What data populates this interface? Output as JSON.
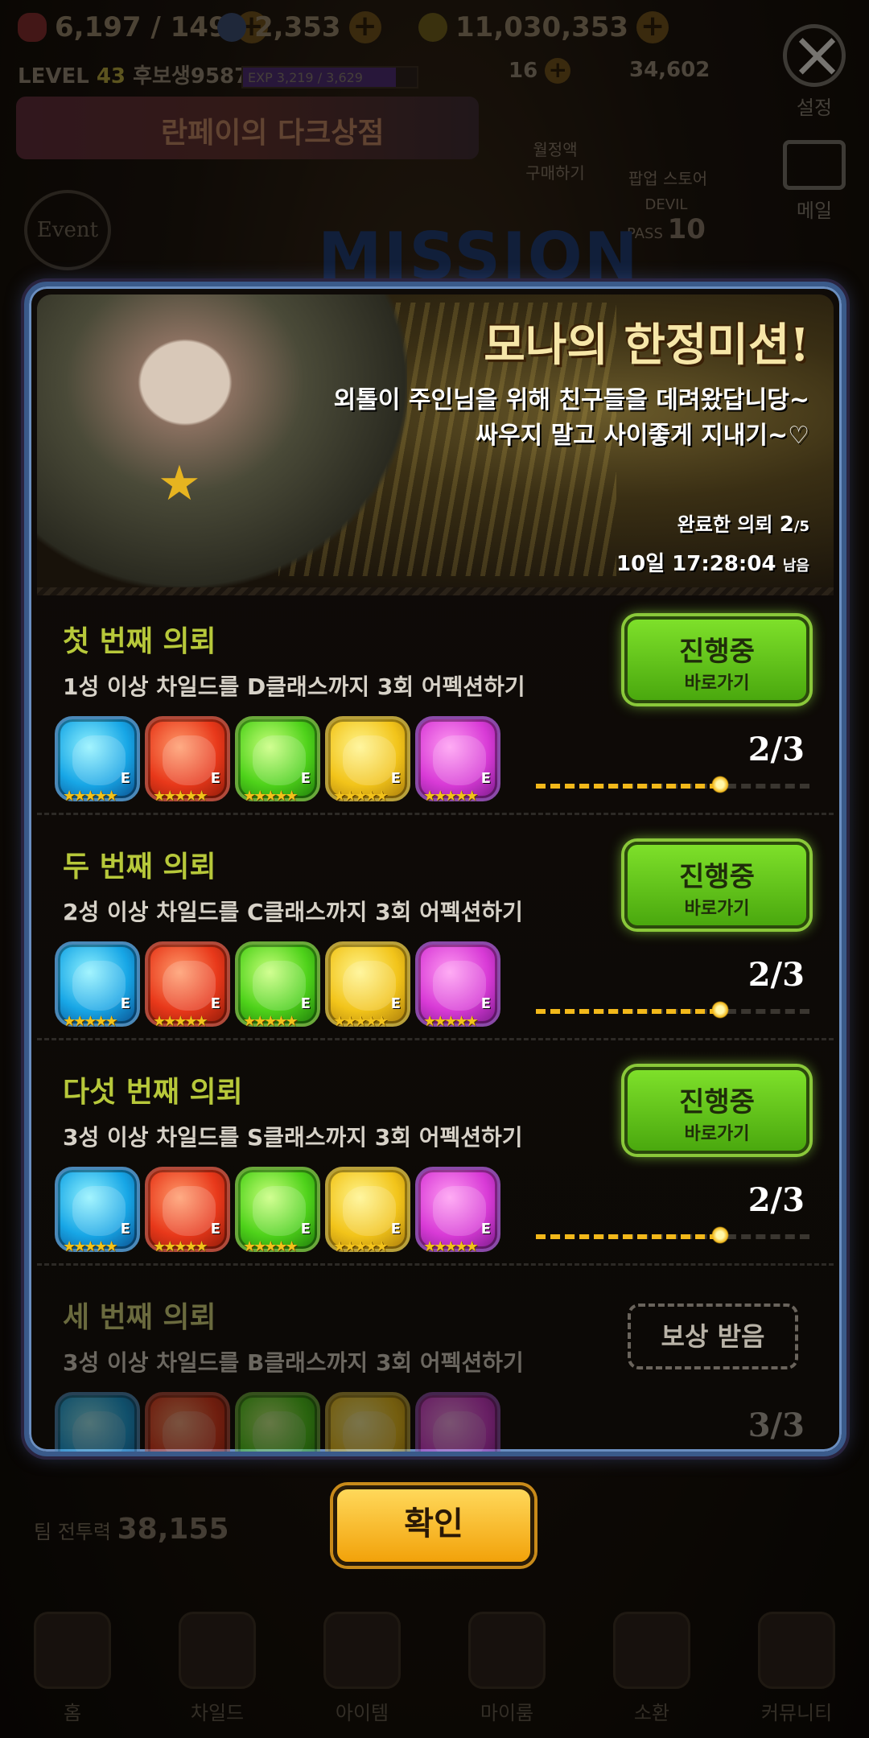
{
  "hud": {
    "stamina": "6,197 / 149",
    "gems": "2,353",
    "gold": "11,030,353",
    "level_label": "LEVEL",
    "level_value": "43",
    "player_name": "후보생9587848",
    "exp_text": "EXP 3,219 / 3,629",
    "item_a": "16",
    "item_b": "34,602",
    "banner_text": "란페이의 다크상점",
    "monthly_label": "월정액\n구매하기",
    "popup_store_label": "팝업 스토어",
    "devil_pass": "DEVIL PASS",
    "devil_pass_level": "10",
    "event_badge": "Event",
    "mission_bg": "MISSION",
    "settings_label": "설정",
    "mail_label": "메일",
    "team_power_label": "팀 전투력",
    "team_power_value": "38,155"
  },
  "modal": {
    "title": "모나의 한정미션!",
    "desc_line1": "외톨이 주인님을 위해 친구들을 데려왔답니당~",
    "desc_line2": "싸우지 말고 사이좋게 지내기~♡",
    "completed_label": "완료한 의뢰",
    "completed_value": "2",
    "completed_total": "/5",
    "time_left": "10일 17:28:04",
    "time_suffix": "남음"
  },
  "quests": [
    {
      "title": "첫 번째 의뢰",
      "desc": "1성 이상 차일드를 D클래스까지 3회 어펙션하기",
      "button_main": "진행중",
      "button_sub": "바로가기",
      "progress": "2/3",
      "progress_fraction": 0.667
    },
    {
      "title": "두 번째 의뢰",
      "desc": "2성 이상 차일드를 C클래스까지 3회 어펙션하기",
      "button_main": "진행중",
      "button_sub": "바로가기",
      "progress": "2/3",
      "progress_fraction": 0.667
    },
    {
      "title": "다섯 번째 의뢰",
      "desc": "3성 이상 차일드를 S클래스까지 3회 어펙션하기",
      "button_main": "진행중",
      "button_sub": "바로가기",
      "progress": "2/3",
      "progress_fraction": 0.667
    },
    {
      "title": "세 번째 의뢰",
      "desc": "3성 이상 차일드를 B클래스까지 3회 어펙션하기",
      "button_main": "보상 받음",
      "progress": "3/3",
      "progress_fraction": 1.0
    }
  ],
  "character_grade": "E",
  "character_stars": "★★★★★",
  "confirm_button": "확인",
  "nav": [
    "홈",
    "차일드",
    "아이템",
    "마이룸",
    "소환",
    "커뮤니티"
  ]
}
